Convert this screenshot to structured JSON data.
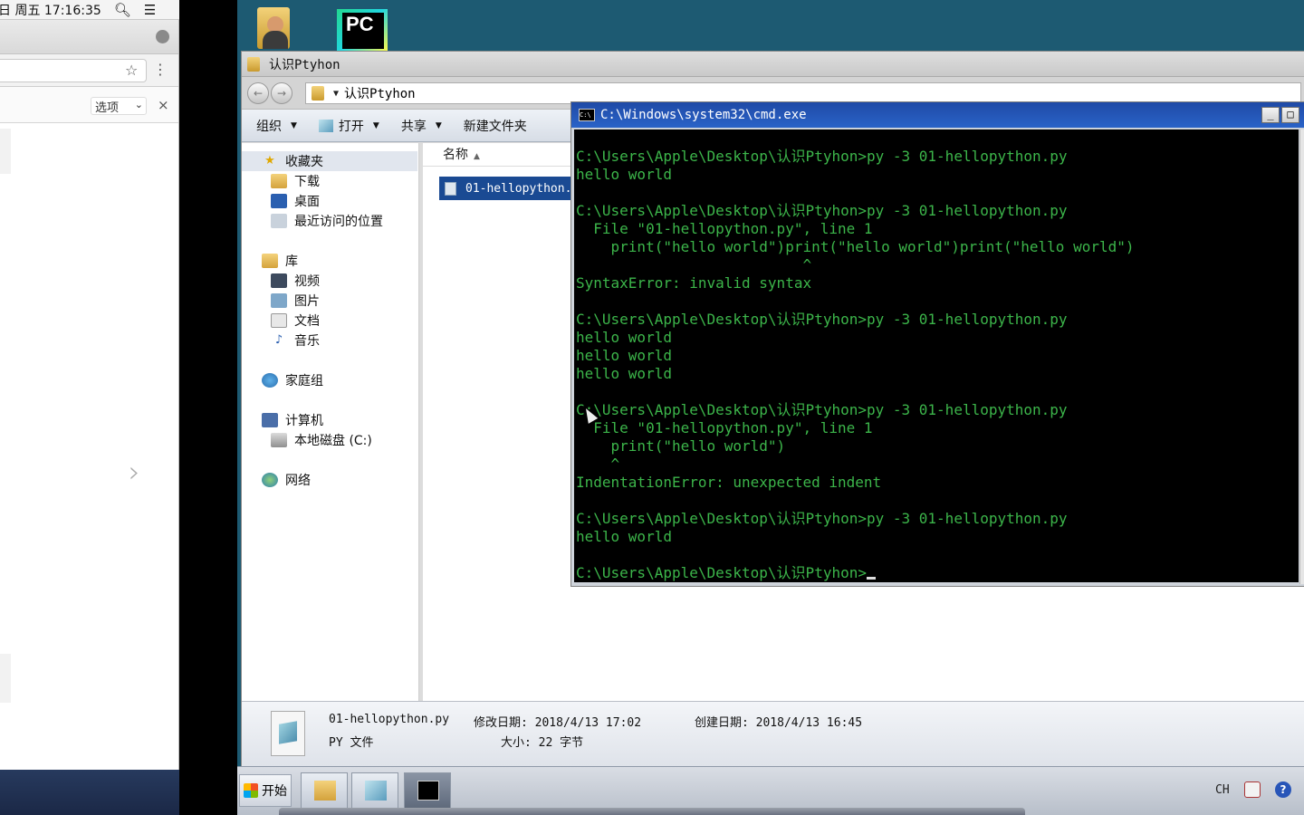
{
  "mac": {
    "menubar": {
      "clock": "日 周五  17:16:35"
    },
    "browser": {
      "find_options_label": "选项",
      "find_close": "×"
    }
  },
  "explorer": {
    "title": "认识Ptyhon",
    "address": "认识Ptyhon",
    "toolbar": {
      "organize": "组织",
      "open": "打开",
      "share": "共享",
      "new_folder": "新建文件夹"
    },
    "nav": {
      "favorites": "收藏夹",
      "downloads": "下载",
      "desktop": "桌面",
      "recent": "最近访问的位置",
      "libraries": "库",
      "videos": "视频",
      "pictures": "图片",
      "documents": "文档",
      "music": "音乐",
      "homegroup": "家庭组",
      "computer": "计算机",
      "local_disk": "本地磁盘 (C:)",
      "network": "网络"
    },
    "column_name": "名称",
    "file_name": "01-hellopython.py",
    "details": {
      "file_name": "01-hellopython.py",
      "modified": "修改日期: 2018/4/13 17:02",
      "created": "创建日期: 2018/4/13 16:45",
      "type": "PY 文件",
      "size": "大小: 22 字节"
    }
  },
  "cmd": {
    "title": "C:\\Windows\\system32\\cmd.exe",
    "lines": [
      "C:\\Users\\Apple\\Desktop\\认识Ptyhon>py -3 01-hellopython.py",
      "hello world",
      "",
      "C:\\Users\\Apple\\Desktop\\认识Ptyhon>py -3 01-hellopython.py",
      "  File \"01-hellopython.py\", line 1",
      "    print(\"hello world\")print(\"hello world\")print(\"hello world\")",
      "                          ^",
      "SyntaxError: invalid syntax",
      "",
      "C:\\Users\\Apple\\Desktop\\认识Ptyhon>py -3 01-hellopython.py",
      "hello world",
      "hello world",
      "hello world",
      "",
      "C:\\Users\\Apple\\Desktop\\认识Ptyhon>py -3 01-hellopython.py",
      "  File \"01-hellopython.py\", line 1",
      "    print(\"hello world\")",
      "    ^",
      "IndentationError: unexpected indent",
      "",
      "C:\\Users\\Apple\\Desktop\\认识Ptyhon>py -3 01-hellopython.py",
      "hello world",
      "",
      "C:\\Users\\Apple\\Desktop\\认识Ptyhon>"
    ]
  },
  "taskbar": {
    "start": "开始",
    "language": "CH",
    "help_glyph": "?"
  },
  "desktop_icons": {
    "pycharm_label": "PC"
  }
}
